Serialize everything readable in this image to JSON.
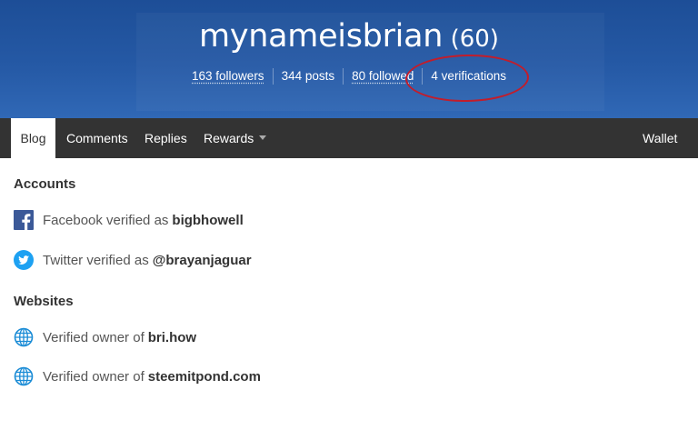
{
  "profile": {
    "name": "mynameisbrian",
    "reputation": "(60)",
    "stats": {
      "followers": "163 followers",
      "posts": "344 posts",
      "followed": "80 followed",
      "verifications": "4 verifications"
    }
  },
  "nav": {
    "tabs": [
      "Blog",
      "Comments",
      "Replies",
      "Rewards"
    ],
    "wallet": "Wallet"
  },
  "accounts": {
    "heading": "Accounts",
    "items": [
      {
        "icon": "facebook-icon",
        "prefix": "Facebook verified as",
        "value": "bigbhowell"
      },
      {
        "icon": "twitter-icon",
        "prefix": "Twitter verified as",
        "value": "@brayanjaguar"
      }
    ]
  },
  "websites": {
    "heading": "Websites",
    "items": [
      {
        "icon": "globe-icon",
        "prefix": "Verified owner of",
        "value": "bri.how"
      },
      {
        "icon": "globe-icon",
        "prefix": "Verified owner of",
        "value": "steemitpond.com"
      }
    ]
  },
  "colors": {
    "header_blue": "#2559a5",
    "nav_dark": "#333333",
    "highlight_red": "#c21d2b",
    "facebook_blue": "#3b5998",
    "twitter_blue": "#1da1f2",
    "globe_blue": "#1b8cd6"
  }
}
